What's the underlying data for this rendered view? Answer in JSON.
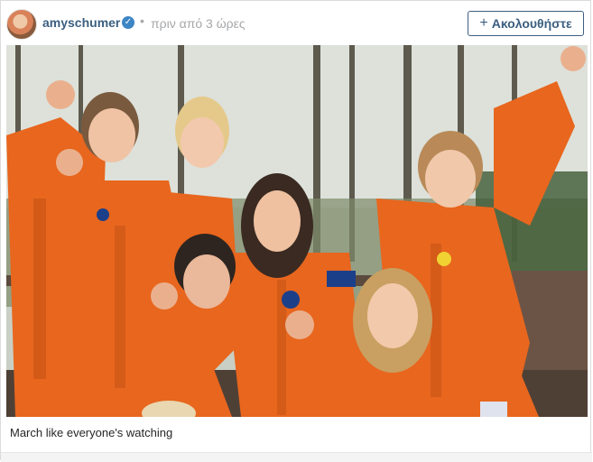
{
  "post": {
    "username": "amyschumer",
    "verified_icon": "verified-badge-icon",
    "separator": "•",
    "timestamp": "πριν από 3 ώρες",
    "follow_label": "Ακολουθήστε",
    "follow_icon": "plus-icon",
    "caption": "March like everyone's watching"
  },
  "colors": {
    "link_blue": "#3b5f80",
    "verified_blue": "#3d86c6",
    "timestamp_gray": "#a5a7aa",
    "jumpsuit_orange": "#e8661e"
  }
}
